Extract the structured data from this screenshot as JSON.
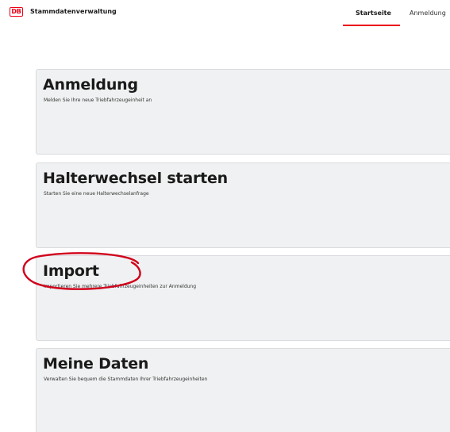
{
  "header": {
    "logo_text": "DB",
    "app_title": "Stammdatenverwaltung",
    "nav": [
      {
        "label": "Startseite",
        "active": true
      },
      {
        "label": "Anmeldung",
        "active": false
      }
    ]
  },
  "cards": [
    {
      "title": "Anmeldung",
      "description": "Melden Sie Ihre neue Triebfahrzeugeinheit an"
    },
    {
      "title": "Halterwechsel starten",
      "description": "Starten Sie eine neue Halterwechselanfrage"
    },
    {
      "title": "Import",
      "description": "Importieren Sie mehrere Triebfahrzeugeinheiten zur Anmeldung"
    },
    {
      "title": "Meine Daten",
      "description": "Verwalten Sie bequem die Stammdaten Ihrer Triebfahrzeugeinheiten"
    }
  ],
  "colors": {
    "brand": "#ec0016",
    "card_background": "#f0f1f2",
    "annotation": "#d0021b"
  },
  "annotation": {
    "type": "ellipse-highlight",
    "target": "Import"
  }
}
